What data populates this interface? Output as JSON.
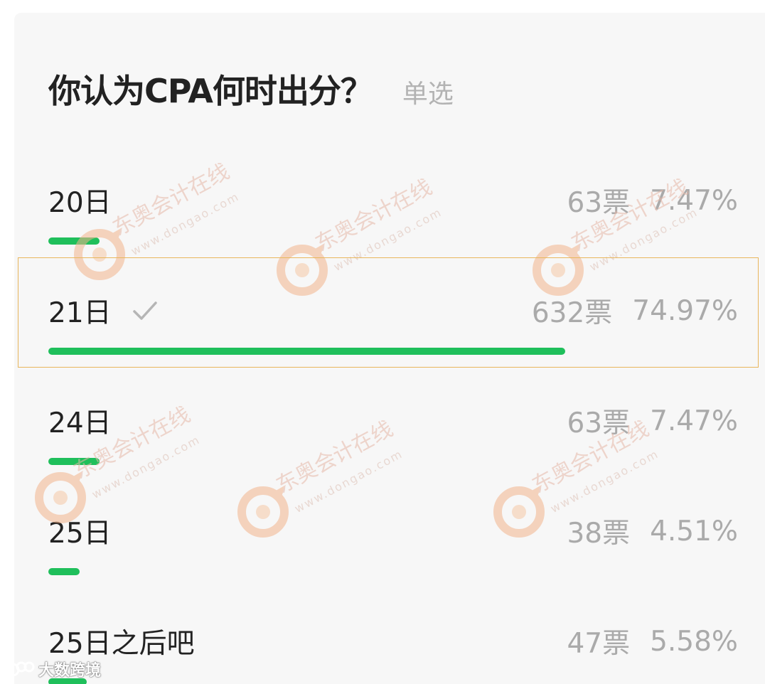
{
  "poll": {
    "question": "你认为CPA何时出分？",
    "type_label": "单选",
    "options": [
      {
        "label": "20日",
        "votes": "63票",
        "percent": "7.47%",
        "fraction": 0.0747,
        "selected": false
      },
      {
        "label": "21日",
        "votes": "632票",
        "percent": "74.97%",
        "fraction": 0.7497,
        "selected": true
      },
      {
        "label": "24日",
        "votes": "63票",
        "percent": "7.47%",
        "fraction": 0.0747,
        "selected": false
      },
      {
        "label": "25日",
        "votes": "38票",
        "percent": "4.51%",
        "fraction": 0.0451,
        "selected": false
      },
      {
        "label": "25日之后吧",
        "votes": "47票",
        "percent": "5.58%",
        "fraction": 0.0558,
        "selected": false
      }
    ]
  },
  "watermark": {
    "text": "东奥会计在线",
    "url": "www.dongao.com"
  },
  "footer": {
    "mark_text": "大数跨境"
  },
  "colors": {
    "bar": "#1fbf5b",
    "highlight_border": "#e8b65c",
    "stats_text": "#aaaaaa"
  },
  "icons": {
    "selected": "check-icon",
    "watermark_logo": "dongao-logo-icon",
    "footer_logo": "dashu-logo-icon"
  }
}
